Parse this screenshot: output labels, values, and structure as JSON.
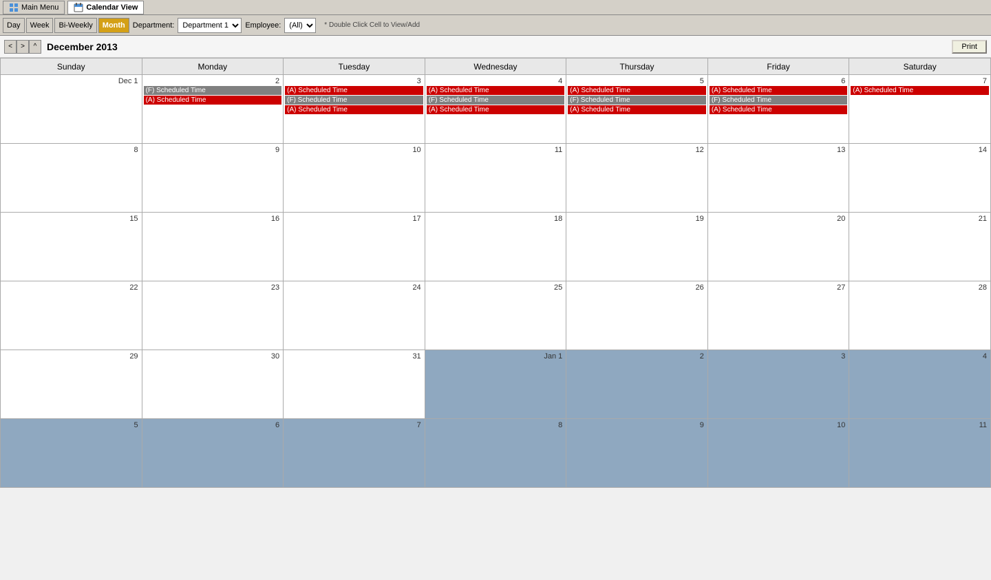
{
  "titlebar": {
    "mainmenu_label": "Main Menu",
    "calview_label": "Calendar View"
  },
  "navbar": {
    "day_label": "Day",
    "week_label": "Week",
    "biweekly_label": "Bi-Weekly",
    "month_label": "Month",
    "department_label": "Department:",
    "department_value": "Department 1",
    "employee_label": "Employee:",
    "employee_value": "(All)",
    "hint": "* Double Click Cell to View/Add"
  },
  "monthnav": {
    "title": "December 2013",
    "print_label": "Print"
  },
  "calendar": {
    "headers": [
      "Sunday",
      "Monday",
      "Tuesday",
      "Wednesday",
      "Thursday",
      "Friday",
      "Saturday"
    ],
    "weeks": [
      [
        {
          "num": "Dec 1",
          "other": false,
          "events": []
        },
        {
          "num": "2",
          "other": false,
          "events": [
            {
              "label": "(F) Scheduled Time",
              "type": "gray"
            },
            {
              "label": "(A) Scheduled Time",
              "type": "red"
            }
          ]
        },
        {
          "num": "3",
          "other": false,
          "events": [
            {
              "label": "(A) Scheduled Time",
              "type": "red"
            },
            {
              "label": "(F) Scheduled Time",
              "type": "gray"
            },
            {
              "label": "(A) Scheduled Time",
              "type": "red"
            }
          ]
        },
        {
          "num": "4",
          "other": false,
          "events": [
            {
              "label": "(A) Scheduled Time",
              "type": "red"
            },
            {
              "label": "(F) Scheduled Time",
              "type": "gray"
            },
            {
              "label": "(A) Scheduled Time",
              "type": "red"
            }
          ]
        },
        {
          "num": "5",
          "other": false,
          "events": [
            {
              "label": "(A) Scheduled Time",
              "type": "red"
            },
            {
              "label": "(F) Scheduled Time",
              "type": "gray"
            },
            {
              "label": "(A) Scheduled Time",
              "type": "red"
            }
          ]
        },
        {
          "num": "6",
          "other": false,
          "events": [
            {
              "label": "(A) Scheduled Time",
              "type": "red"
            },
            {
              "label": "(F) Scheduled Time",
              "type": "gray"
            },
            {
              "label": "(A) Scheduled Time",
              "type": "red"
            }
          ]
        },
        {
          "num": "7",
          "other": false,
          "events": [
            {
              "label": "(A) Scheduled Time",
              "type": "red"
            }
          ]
        }
      ],
      [
        {
          "num": "8",
          "other": false,
          "events": []
        },
        {
          "num": "9",
          "other": false,
          "events": []
        },
        {
          "num": "10",
          "other": false,
          "events": []
        },
        {
          "num": "11",
          "other": false,
          "events": []
        },
        {
          "num": "12",
          "other": false,
          "events": []
        },
        {
          "num": "13",
          "other": false,
          "events": []
        },
        {
          "num": "14",
          "other": false,
          "events": []
        }
      ],
      [
        {
          "num": "15",
          "other": false,
          "events": []
        },
        {
          "num": "16",
          "other": false,
          "events": []
        },
        {
          "num": "17",
          "other": false,
          "events": []
        },
        {
          "num": "18",
          "other": false,
          "events": []
        },
        {
          "num": "19",
          "other": false,
          "events": []
        },
        {
          "num": "20",
          "other": false,
          "events": []
        },
        {
          "num": "21",
          "other": false,
          "events": []
        }
      ],
      [
        {
          "num": "22",
          "other": false,
          "events": []
        },
        {
          "num": "23",
          "other": false,
          "events": []
        },
        {
          "num": "24",
          "other": false,
          "events": []
        },
        {
          "num": "25",
          "other": false,
          "events": []
        },
        {
          "num": "26",
          "other": false,
          "events": []
        },
        {
          "num": "27",
          "other": false,
          "events": []
        },
        {
          "num": "28",
          "other": false,
          "events": []
        }
      ],
      [
        {
          "num": "29",
          "other": false,
          "events": []
        },
        {
          "num": "30",
          "other": false,
          "events": []
        },
        {
          "num": "31",
          "other": false,
          "events": []
        },
        {
          "num": "Jan 1",
          "other": true,
          "events": []
        },
        {
          "num": "2",
          "other": true,
          "events": []
        },
        {
          "num": "3",
          "other": true,
          "events": []
        },
        {
          "num": "4",
          "other": true,
          "events": []
        }
      ],
      [
        {
          "num": "5",
          "other": true,
          "events": []
        },
        {
          "num": "6",
          "other": true,
          "events": []
        },
        {
          "num": "7",
          "other": true,
          "events": []
        },
        {
          "num": "8",
          "other": true,
          "events": []
        },
        {
          "num": "9",
          "other": true,
          "events": []
        },
        {
          "num": "10",
          "other": true,
          "events": []
        },
        {
          "num": "11",
          "other": true,
          "events": []
        }
      ]
    ]
  }
}
